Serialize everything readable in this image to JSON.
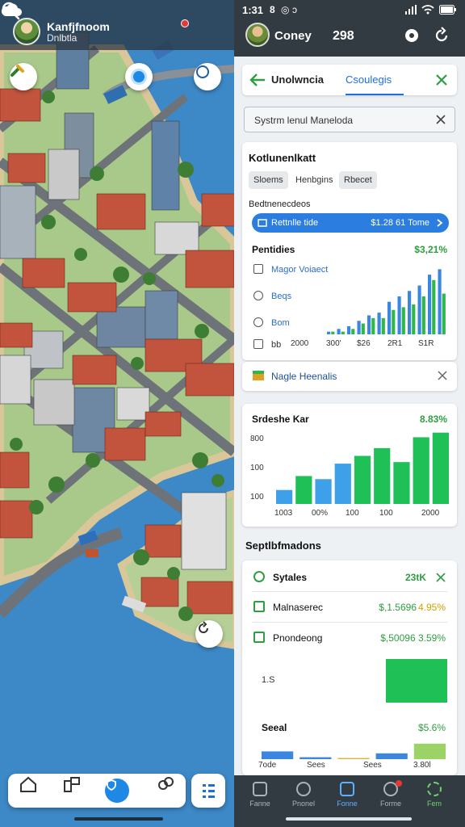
{
  "left": {
    "player_name": "Kanfjfnoom",
    "player_subtitle": "Dnlbtla",
    "icons": {
      "notification": "cloud-notification-icon",
      "search": "search-icon",
      "build": "hammer-icon",
      "locate": "location-target-icon",
      "refresh": "refresh-icon",
      "rotate": "rotate-icon"
    },
    "bottom_nav": [
      {
        "icon": "home-icon"
      },
      {
        "icon": "buildings-icon"
      },
      {
        "icon": "shield-icon"
      },
      {
        "icon": "link-icon"
      }
    ],
    "menu_icon": "grid-menu-icon"
  },
  "status_bar": {
    "time": "1:31",
    "indicators": [
      "8",
      "◎",
      "ɔ"
    ]
  },
  "header": {
    "name": "Coney",
    "coins": "298"
  },
  "tabs": {
    "active": "Unolwncia",
    "inactive": "Csoulegis"
  },
  "search": {
    "value": "Systrm lenul Maneloda"
  },
  "market": {
    "title": "Kotlunenlkatt",
    "chips": [
      "Sloems",
      "Henbgins",
      "Rbecet"
    ],
    "section_label": "Bedtnenecdeos",
    "pill_left": "Rettnlle tide",
    "pill_right": "$1.28 61 Tome",
    "subtitle": "Pentidies",
    "subtitle_value": "$3,21%",
    "list": [
      "Magor Voiaect",
      "Beqs",
      "Bom",
      "bb"
    ],
    "axis_labels": [
      "2000",
      "300'",
      "$26",
      "2R1",
      "S1R"
    ]
  },
  "notice": {
    "text": "Nagle Heenalis"
  },
  "chart2": {
    "title": "Srdeshe Kar",
    "value": "8.83%",
    "y_labels": [
      "800",
      "100",
      "100"
    ],
    "x_labels": [
      "1003",
      "00%",
      "100",
      "100",
      "2000"
    ]
  },
  "settlements": {
    "section_title": "Septlbfmadons",
    "rows": [
      {
        "label": "Sytales",
        "value": "23tK"
      },
      {
        "label": "Malnaserec",
        "value": "$,1.5696",
        "value2": "4.95%"
      },
      {
        "label": "Pnondeong",
        "value": "$,50096 3.59%"
      }
    ],
    "side_number": "1.S",
    "total_label": "Seeal",
    "total_value": "$5.6%",
    "mini_axis": [
      "7ode",
      "Sees",
      "Sees",
      "3.80l"
    ]
  },
  "panel_nav": [
    {
      "label": "Fanne"
    },
    {
      "label": "Pnonel"
    },
    {
      "label": "Fonne"
    },
    {
      "label": "Forme"
    },
    {
      "label": "Fem"
    }
  ],
  "chart_data": [
    {
      "type": "bar",
      "title": "Pentidies",
      "series": [
        {
          "values": [
            1,
            2,
            3,
            5,
            7,
            8,
            12,
            14,
            16,
            18,
            22,
            24
          ]
        },
        {
          "values": [
            1,
            1,
            2,
            4,
            6,
            6,
            9,
            10,
            11,
            14,
            20,
            15
          ]
        }
      ],
      "colors": [
        "#3a86e0",
        "#2eb84b"
      ]
    },
    {
      "type": "bar",
      "title": "Srdeshe Kar",
      "values": [
        18,
        36,
        32,
        52,
        62,
        72,
        54,
        86,
        92
      ],
      "colors": [
        "#3ea0e8",
        "#1fc157",
        "#3ea0e8",
        "#3ea0e8",
        "#1fc157",
        "#1fc157",
        "#1fc157",
        "#1fc157",
        "#1fc157"
      ]
    },
    {
      "type": "bar",
      "title": "Seeal",
      "values": [
        40,
        10,
        6,
        30,
        80
      ],
      "colors": [
        "#3a86e0",
        "#3a86e0",
        "#e0b339",
        "#3a86e0",
        "#9bd366"
      ]
    }
  ]
}
